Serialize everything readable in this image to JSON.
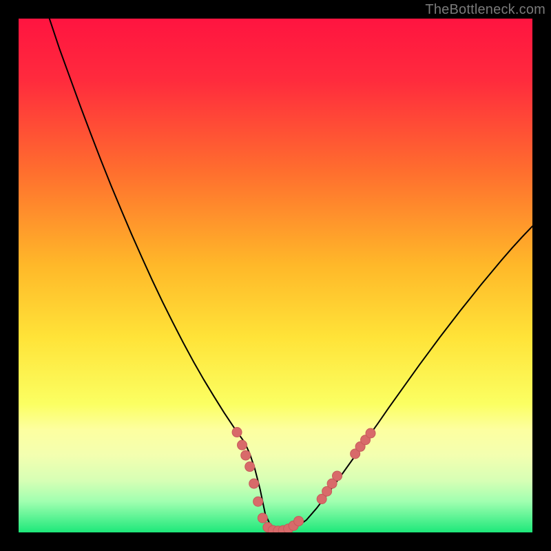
{
  "watermark": "TheBottleneck.com",
  "colors": {
    "frame": "#000000",
    "gradient_top": "#ff1a3e",
    "gradient_mid_upper": "#ff7a2a",
    "gradient_mid": "#ffd423",
    "gradient_mid_lower": "#faff66",
    "gradient_bottom": "#22e86b",
    "curve": "#000000",
    "marker_fill": "#d86a6a",
    "marker_stroke": "#c65a5a"
  },
  "chart_data": {
    "type": "line",
    "title": "",
    "xlabel": "",
    "ylabel": "",
    "xlim": [
      0,
      100
    ],
    "ylim": [
      0,
      100
    ],
    "series": [
      {
        "name": "bottleneck-curve",
        "x": [
          6,
          8,
          10,
          12,
          14,
          16,
          18,
          20,
          22,
          24,
          26,
          28,
          30,
          32,
          34,
          36,
          38,
          40,
          42,
          44,
          45,
          46,
          47,
          48,
          49,
          50,
          51,
          52,
          54,
          56,
          58,
          60,
          62,
          64,
          66,
          68,
          70,
          72,
          74,
          76,
          78,
          80,
          82,
          84,
          86,
          88,
          90,
          92,
          94,
          96,
          98,
          100
        ],
        "y": [
          100,
          94,
          88.5,
          83,
          77.7,
          72.5,
          67.5,
          62.7,
          58,
          53.5,
          49.1,
          44.9,
          40.9,
          37,
          33.3,
          29.8,
          26.5,
          23.3,
          20.3,
          17.5,
          15.3,
          12.3,
          8.4,
          3.6,
          1.4,
          0.5,
          0.3,
          0.4,
          1.0,
          2.4,
          4.7,
          7.3,
          10.0,
          12.8,
          15.6,
          18.5,
          21.3,
          24.2,
          27.0,
          29.8,
          32.6,
          35.3,
          38.0,
          40.6,
          43.2,
          45.7,
          48.2,
          50.6,
          53.0,
          55.3,
          57.5,
          59.6
        ]
      }
    ],
    "markers": {
      "name": "highlight-points",
      "points": [
        {
          "x": 42.5,
          "y": 19.5
        },
        {
          "x": 43.5,
          "y": 17.0
        },
        {
          "x": 44.2,
          "y": 15.0
        },
        {
          "x": 45.0,
          "y": 12.8
        },
        {
          "x": 45.8,
          "y": 9.5
        },
        {
          "x": 46.6,
          "y": 6.0
        },
        {
          "x": 47.5,
          "y": 2.8
        },
        {
          "x": 48.5,
          "y": 1.0
        },
        {
          "x": 49.5,
          "y": 0.4
        },
        {
          "x": 50.5,
          "y": 0.3
        },
        {
          "x": 51.5,
          "y": 0.4
        },
        {
          "x": 52.5,
          "y": 0.7
        },
        {
          "x": 53.5,
          "y": 1.3
        },
        {
          "x": 54.5,
          "y": 2.2
        },
        {
          "x": 59.0,
          "y": 6.5
        },
        {
          "x": 60.0,
          "y": 8.0
        },
        {
          "x": 61.0,
          "y": 9.5
        },
        {
          "x": 62.0,
          "y": 11.0
        },
        {
          "x": 65.5,
          "y": 15.3
        },
        {
          "x": 66.5,
          "y": 16.7
        },
        {
          "x": 67.5,
          "y": 18.0
        },
        {
          "x": 68.5,
          "y": 19.3
        }
      ]
    }
  }
}
